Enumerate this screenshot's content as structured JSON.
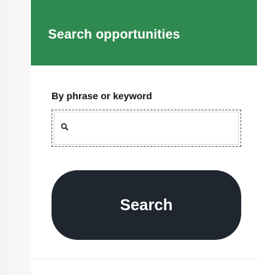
{
  "header": {
    "title": "Search opportunities"
  },
  "search": {
    "label": "By phrase or keyword",
    "value": "",
    "placeholder": "",
    "button_label": "Search"
  },
  "icons": {
    "search": "search-icon"
  },
  "colors": {
    "header_bg": "#2f8a4f",
    "button_bg": "#1f2630",
    "header_text": "#ffffff",
    "body_text": "#111111"
  }
}
